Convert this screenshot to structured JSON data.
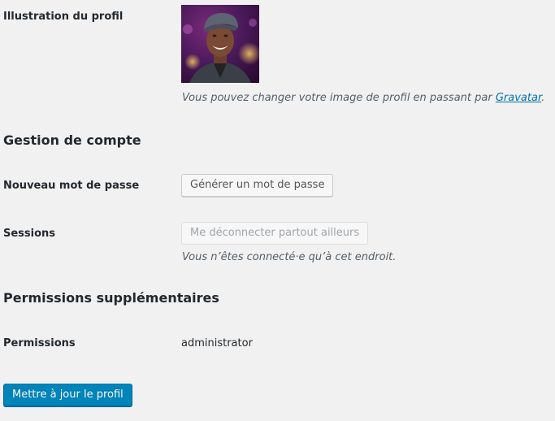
{
  "profile_picture": {
    "label": "Illustration du profil",
    "description": "Vous pouvez changer votre image de profil en passant par",
    "link_text": "Gravatar",
    "description_end": "."
  },
  "account_management": {
    "heading": "Gestion de compte",
    "new_password_label": "Nouveau mot de passe",
    "generate_password_button": "Générer un mot de passe",
    "sessions_label": "Sessions",
    "logout_everywhere_button": "Me déconnecter partout ailleurs",
    "sessions_description": "Vous n’êtes connecté·e qu’à cet endroit."
  },
  "extra_permissions": {
    "heading": "Permissions supplémentaires",
    "permissions_label": "Permissions",
    "permissions_value": "administrator"
  },
  "update_profile_button": "Mettre à jour le profil",
  "colors": {
    "primary": "#0085ba",
    "link": "#0073aa",
    "background": "#f1f1f1"
  }
}
